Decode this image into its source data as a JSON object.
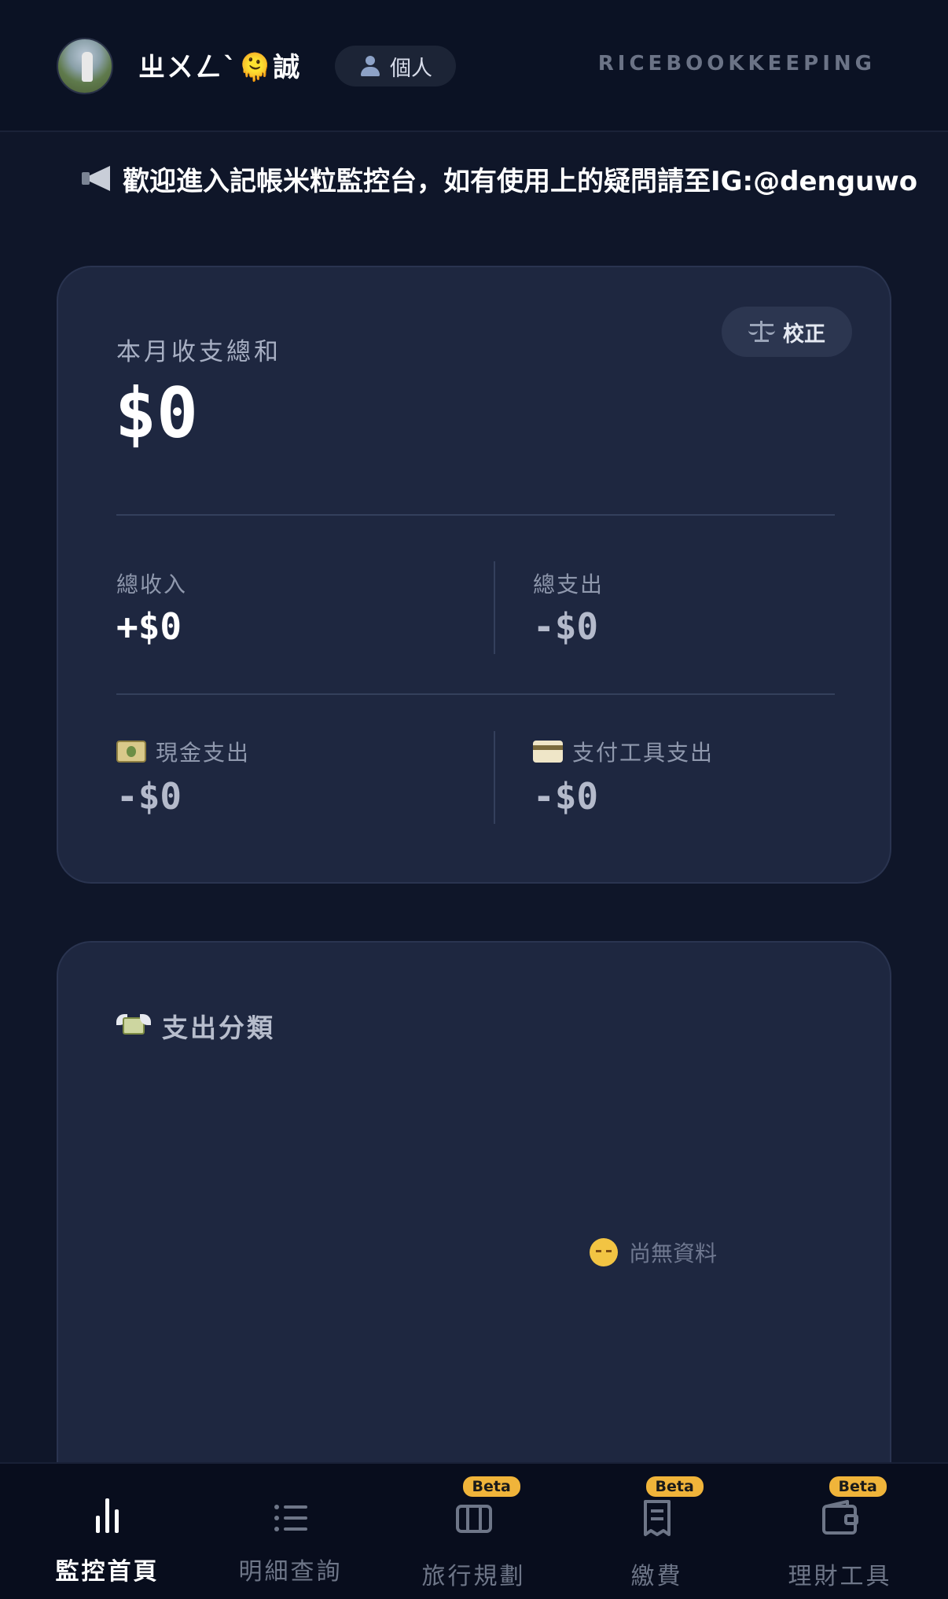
{
  "header": {
    "username": "ㄓㄨㄥˋ🫠誠",
    "mode_label": "個人",
    "brand": "RICEBOOKKEEPING"
  },
  "announcement": {
    "text": "歡迎進入記帳米粒監控台，如有使用上的疑問請至IG:@denguwo"
  },
  "summary": {
    "calibrate_label": "校正",
    "total_label": "本月收支總和",
    "total_value": "$0",
    "income_label": "總收入",
    "income_value": "+$0",
    "expense_label": "總支出",
    "expense_value": "-$0",
    "cash_label": "現金支出",
    "cash_value": "-$0",
    "payment_label": "支付工具支出",
    "payment_value": "-$0"
  },
  "category": {
    "title": "支出分類",
    "empty_text": "尚無資料"
  },
  "nav": {
    "items": [
      {
        "label": "監控首頁",
        "icon": "bar-chart-icon",
        "active": true,
        "beta": false
      },
      {
        "label": "明細查詢",
        "icon": "list-icon",
        "active": false,
        "beta": false
      },
      {
        "label": "旅行規劃",
        "icon": "luggage-icon",
        "active": false,
        "beta": true
      },
      {
        "label": "繳費",
        "icon": "receipt-icon",
        "active": false,
        "beta": true
      },
      {
        "label": "理財工具",
        "icon": "wallet-icon",
        "active": false,
        "beta": true
      }
    ],
    "beta_label": "Beta"
  },
  "colors": {
    "background": "#0f1629",
    "card": "#1e2740",
    "accent_badge": "#f0b43a"
  }
}
